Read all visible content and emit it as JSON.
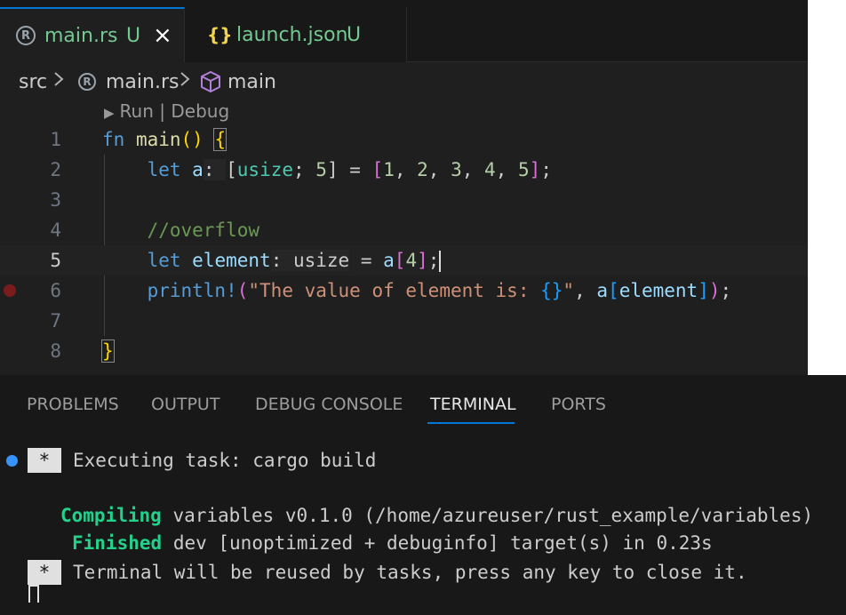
{
  "tabs": [
    {
      "icon": "rust-icon",
      "label": "main.rs",
      "status": "U",
      "active": true
    },
    {
      "icon": "json-icon",
      "label": "launch.json",
      "status": "U",
      "active": false
    }
  ],
  "breadcrumb": {
    "folder": "src",
    "separator": ">",
    "file": "main.rs",
    "symbol": "main"
  },
  "codelens": {
    "run": "Run",
    "divider": "|",
    "debug": "Debug"
  },
  "editor": {
    "current_line": 5,
    "breakpoint_line": 6,
    "lines": [
      "fn main() {",
      "    let a: [usize; 5] = [1, 2, 3, 4, 5];",
      "",
      "    //overflow",
      "    let element: usize = a[4];",
      "    println!(\"The value of element is: {}\", a[element]);",
      "",
      "}"
    ],
    "line_numbers": [
      "1",
      "2",
      "3",
      "4",
      "5",
      "6",
      "7",
      "8"
    ]
  },
  "panel": {
    "tabs": [
      "PROBLEMS",
      "OUTPUT",
      "DEBUG CONSOLE",
      "TERMINAL",
      "PORTS"
    ],
    "active_tab": "TERMINAL"
  },
  "terminal": {
    "task_marker": "*",
    "task_line": "Executing task: cargo build",
    "compiling_label": "Compiling",
    "compiling_text": "variables v0.1.0 (/home/azureuser/rust_example/variables)",
    "finished_label": "Finished",
    "finished_text": "dev [unoptimized + debuginfo] target(s) in 0.23s",
    "reuse_marker": "*",
    "reuse_line": "Terminal will be reused by tasks, press any key to close it."
  },
  "colors": {
    "accent": "#0078d4",
    "modified": "#73c991",
    "breakpoint": "#7a1c1c",
    "task_dot": "#3794ff",
    "terminal_green": "#23d18b"
  }
}
